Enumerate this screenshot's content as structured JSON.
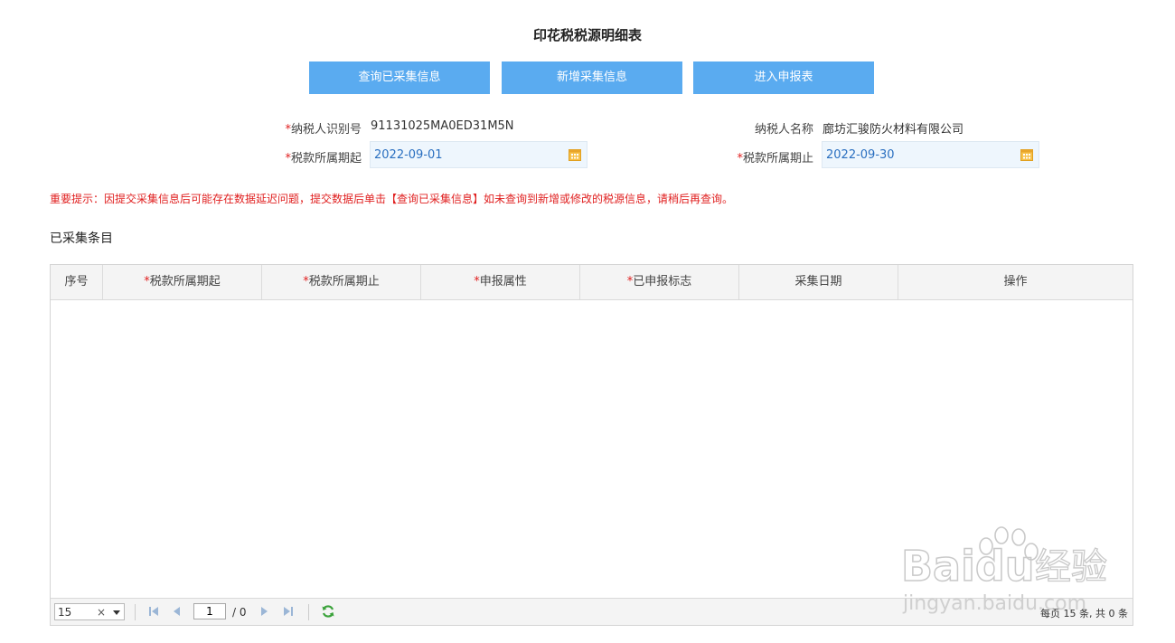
{
  "page": {
    "title": "印花税税源明细表"
  },
  "buttons": {
    "query": "查询已采集信息",
    "add": "新增采集信息",
    "enter": "进入申报表"
  },
  "form": {
    "taxpayer_id_label": "纳税人识别号",
    "taxpayer_id_value": "91131025MA0ED31M5N",
    "taxpayer_name_label": "纳税人名称",
    "taxpayer_name_value": "廊坊汇骏防火材料有限公司",
    "period_start_label": "税款所属期起",
    "period_start_value": "2022-09-01",
    "period_end_label": "税款所属期止",
    "period_end_value": "2022-09-30",
    "required_mark": "*"
  },
  "notice": "重要提示：因提交采集信息后可能存在数据延迟问题，提交数据后单击【查询已采集信息】如未查询到新增或修改的税源信息，请稍后再查询。",
  "section_title": "已采集条目",
  "table": {
    "columns": [
      {
        "label": "序号",
        "required": false
      },
      {
        "label": "税款所属期起",
        "required": true
      },
      {
        "label": "税款所属期止",
        "required": true
      },
      {
        "label": "申报属性",
        "required": true
      },
      {
        "label": "已申报标志",
        "required": true
      },
      {
        "label": "采集日期",
        "required": false
      },
      {
        "label": "操作",
        "required": false
      }
    ],
    "rows": []
  },
  "pager": {
    "page_size": "15",
    "clear_symbol": "×",
    "current_page": "1",
    "total_pages": "/ 0",
    "info": "每页 15 条, 共 0 条"
  },
  "watermark": {
    "brand": "Baidu",
    "brand_cn": "经验",
    "url": "jingyan.baidu.com"
  },
  "colors": {
    "button_bg": "#5aabf0",
    "required": "#e02020",
    "date_text": "#2a6fc0"
  }
}
